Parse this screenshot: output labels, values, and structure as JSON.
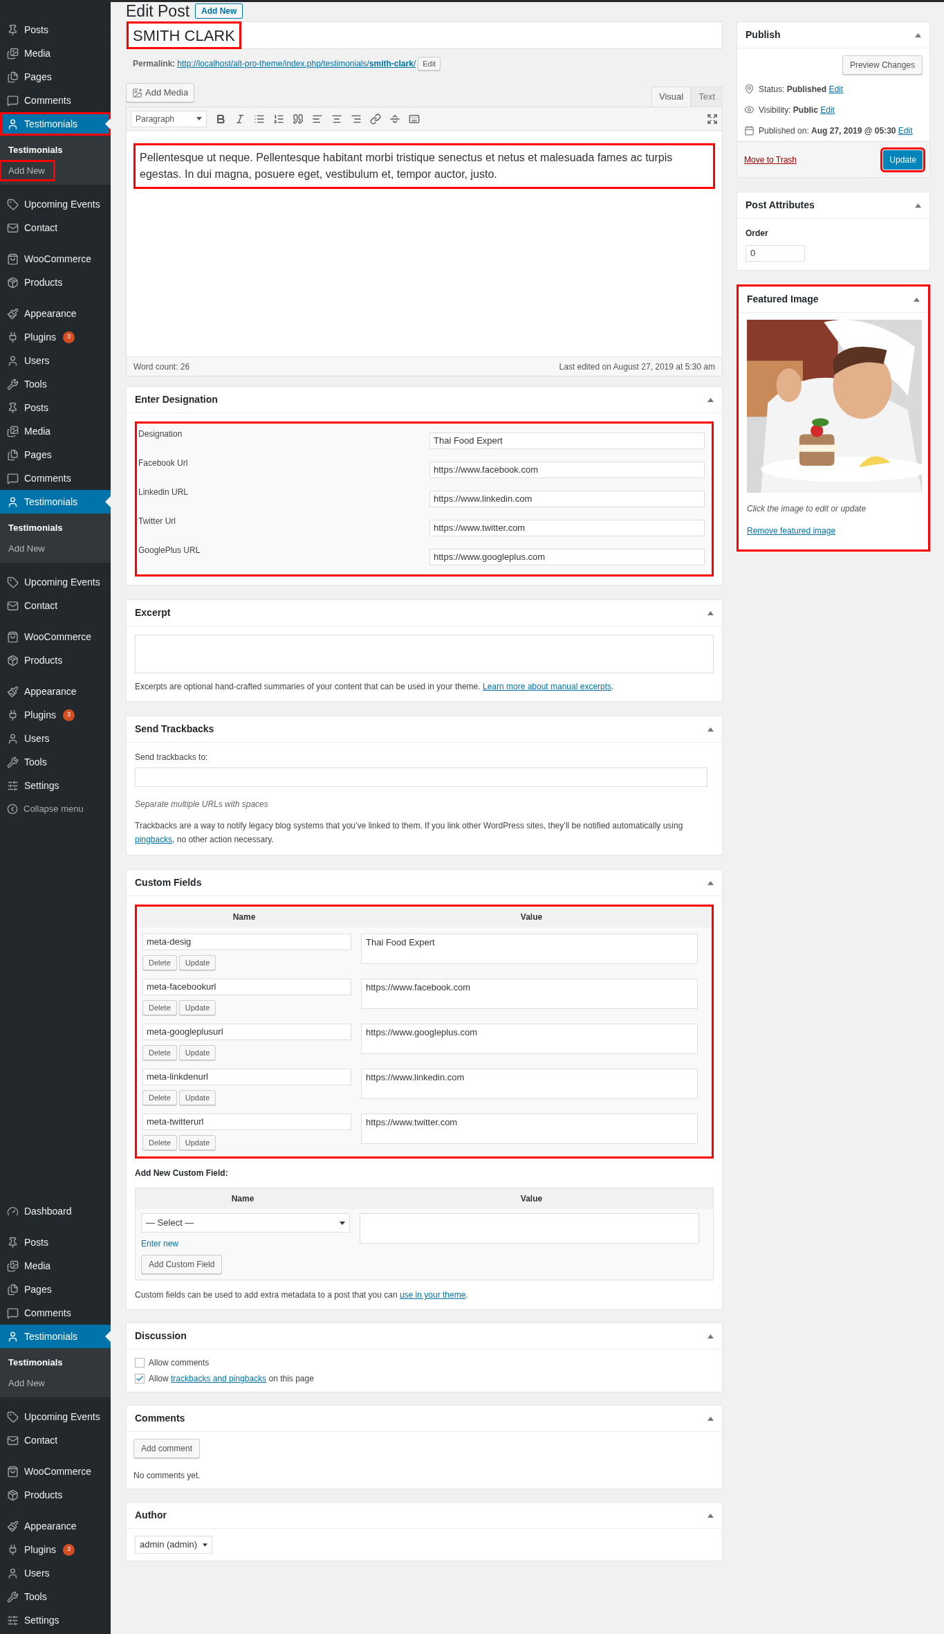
{
  "sidebar": {
    "menus": [
      {
        "sections": [
          [
            {
              "label": "Posts",
              "kind": "pin",
              "selected": false,
              "annotated": false
            },
            {
              "label": "Media",
              "kind": "media",
              "selected": false,
              "annotated": false
            },
            {
              "label": "Pages",
              "kind": "pages",
              "selected": false,
              "annotated": false
            },
            {
              "label": "Comments",
              "kind": "comment",
              "selected": false,
              "annotated": false
            },
            {
              "label": "Testimonials",
              "kind": "person",
              "selected": true,
              "annotated": true,
              "submenu": [
                {
                  "label": "Testimonials",
                  "selected": true,
                  "annotated": false
                },
                {
                  "label": "Add New",
                  "selected": false,
                  "annotated": true
                }
              ]
            }
          ],
          [
            {
              "label": "Upcoming Events",
              "kind": "tag",
              "selected": false,
              "annotated": false
            },
            {
              "label": "Contact",
              "kind": "mail",
              "selected": false,
              "annotated": false
            }
          ],
          [
            {
              "label": "WooCommerce",
              "kind": "woo",
              "selected": false,
              "annotated": false
            },
            {
              "label": "Products",
              "kind": "box",
              "selected": false,
              "annotated": false
            }
          ],
          [
            {
              "label": "Appearance",
              "kind": "brush",
              "selected": false,
              "annotated": false
            },
            {
              "label": "Plugins",
              "kind": "plug",
              "selected": false,
              "annotated": false,
              "badge": "3"
            },
            {
              "label": "Users",
              "kind": "person",
              "selected": false,
              "annotated": false
            },
            {
              "label": "Tools",
              "kind": "wrench",
              "selected": false,
              "annotated": false
            }
          ]
        ]
      },
      {
        "sections": [
          [
            {
              "label": "Posts",
              "kind": "pin",
              "selected": false,
              "annotated": false
            },
            {
              "label": "Media",
              "kind": "media",
              "selected": false,
              "annotated": false
            },
            {
              "label": "Pages",
              "kind": "pages",
              "selected": false,
              "annotated": false
            },
            {
              "label": "Comments",
              "kind": "comment",
              "selected": false,
              "annotated": false
            },
            {
              "label": "Testimonials",
              "kind": "person",
              "selected": true,
              "annotated": false,
              "submenu": [
                {
                  "label": "Testimonials",
                  "selected": true,
                  "annotated": false
                },
                {
                  "label": "Add New",
                  "selected": false,
                  "annotated": false
                }
              ]
            }
          ],
          [
            {
              "label": "Upcoming Events",
              "kind": "tag",
              "selected": false,
              "annotated": false
            },
            {
              "label": "Contact",
              "kind": "mail",
              "selected": false,
              "annotated": false
            }
          ],
          [
            {
              "label": "WooCommerce",
              "kind": "woo",
              "selected": false,
              "annotated": false
            },
            {
              "label": "Products",
              "kind": "box",
              "selected": false,
              "annotated": false
            }
          ],
          [
            {
              "label": "Appearance",
              "kind": "brush",
              "selected": false,
              "annotated": false
            },
            {
              "label": "Plugins",
              "kind": "plug",
              "selected": false,
              "annotated": false,
              "badge": "3"
            },
            {
              "label": "Users",
              "kind": "person",
              "selected": false,
              "annotated": false
            },
            {
              "label": "Tools",
              "kind": "wrench",
              "selected": false,
              "annotated": false
            },
            {
              "label": "Settings",
              "kind": "sliders",
              "selected": false,
              "annotated": false
            },
            {
              "label": "Collapse menu",
              "kind": "collapse",
              "selected": false,
              "annotated": false
            }
          ]
        ]
      },
      {
        "sections": [
          [
            {
              "label": "Dashboard",
              "kind": "gauge",
              "selected": false,
              "annotated": false
            }
          ],
          [
            {
              "label": "Posts",
              "kind": "pin",
              "selected": false,
              "annotated": false
            },
            {
              "label": "Media",
              "kind": "media",
              "selected": false,
              "annotated": false
            },
            {
              "label": "Pages",
              "kind": "pages",
              "selected": false,
              "annotated": false
            },
            {
              "label": "Comments",
              "kind": "comment",
              "selected": false,
              "annotated": false
            },
            {
              "label": "Testimonials",
              "kind": "person",
              "selected": true,
              "annotated": false,
              "submenu": [
                {
                  "label": "Testimonials",
                  "selected": true,
                  "annotated": false
                },
                {
                  "label": "Add New",
                  "selected": false,
                  "annotated": false
                }
              ]
            }
          ],
          [
            {
              "label": "Upcoming Events",
              "kind": "tag",
              "selected": false,
              "annotated": false
            },
            {
              "label": "Contact",
              "kind": "mail",
              "selected": false,
              "annotated": false
            }
          ],
          [
            {
              "label": "WooCommerce",
              "kind": "woo",
              "selected": false,
              "annotated": false
            },
            {
              "label": "Products",
              "kind": "box",
              "selected": false,
              "annotated": false
            }
          ],
          [
            {
              "label": "Appearance",
              "kind": "brush",
              "selected": false,
              "annotated": false
            },
            {
              "label": "Plugins",
              "kind": "plug",
              "selected": false,
              "annotated": false,
              "badge": "3"
            },
            {
              "label": "Users",
              "kind": "person",
              "selected": false,
              "annotated": false
            },
            {
              "label": "Tools",
              "kind": "wrench",
              "selected": false,
              "annotated": false
            },
            {
              "label": "Settings",
              "kind": "sliders",
              "selected": false,
              "annotated": false
            }
          ]
        ]
      }
    ]
  },
  "heading": {
    "title": "Edit Post",
    "add_new": "Add New"
  },
  "title_field": {
    "value": "SMITH CLARK",
    "annotated": true
  },
  "permalink": {
    "label": "Permalink:",
    "url": "http://localhost/alt-pro-theme/index.php/testimonials/**smith-clark**/",
    "edit": "Edit"
  },
  "editor": {
    "add_media": "Add Media",
    "tabs": [
      {
        "label": "Visual",
        "selected": true
      },
      {
        "label": "Text",
        "selected": false
      }
    ],
    "format": "Paragraph",
    "content": "Pellentesque ut neque. Pellentesque habitant morbi tristique senectus et netus et malesuada fames ac turpis egestas. In dui magna, posuere eget, vestibulum et, tempor auctor, justo.",
    "content_annotated": true,
    "word_count": "Word count: 26",
    "last_edited": "Last edited on August 27, 2019 at 5:30 am"
  },
  "designation": {
    "title": "Enter Designation",
    "annotated": true,
    "fields": [
      {
        "label": "Designation",
        "value": "Thai Food Expert"
      },
      {
        "label": "Facebook Url",
        "value": "https://www.facebook.com"
      },
      {
        "label": "Linkedin URL",
        "value": "https://www.linkedin.com"
      },
      {
        "label": "Twitter Url",
        "value": "https://www.twitter.com"
      },
      {
        "label": "GooglePlus URL",
        "value": "https://www.googleplus.com"
      }
    ]
  },
  "excerpt": {
    "title": "Excerpt",
    "help": "Excerpts are optional hand-crafted summaries of your content that can be used in your theme.",
    "link": "Learn more about manual excerpts",
    "after": "."
  },
  "trackbacks": {
    "title": "Send Trackbacks",
    "label": "Send trackbacks to:",
    "hint": "Separate multiple URLs with spaces",
    "text": "Trackbacks are a way to notify legacy blog systems that you’ve linked to them. If you link other WordPress sites, they’ll be notified automatically using",
    "link": "pingbacks",
    "after": ", no other action necessary."
  },
  "custom_fields": {
    "title": "Custom Fields",
    "annotated": true,
    "columns": [
      "Name",
      "Value"
    ],
    "rows": [
      {
        "name": "meta-desig",
        "value": "Thai Food Expert",
        "buttons": [
          "Delete",
          "Update"
        ]
      },
      {
        "name": "meta-facebookurl",
        "value": "https://www.facebook.com",
        "buttons": [
          "Delete",
          "Update"
        ]
      },
      {
        "name": "meta-googleplusurl",
        "value": "https://www.googleplus.com",
        "buttons": [
          "Delete",
          "Update"
        ]
      },
      {
        "name": "meta-linkdenurl",
        "value": "https://www.linkedin.com",
        "buttons": [
          "Delete",
          "Update"
        ]
      },
      {
        "name": "meta-twitterurl",
        "value": "https://www.twitter.com",
        "buttons": [
          "Delete",
          "Update"
        ]
      }
    ],
    "add_new": {
      "title": "Add New Custom Field:",
      "columns": [
        "Name",
        "Value"
      ],
      "select": "— Select —",
      "enter_new": "Enter new",
      "button": "Add Custom Field"
    },
    "help": "Custom fields can be used to add extra metadata to a post that you can",
    "link": "use in your theme",
    "after": "."
  },
  "discussion": {
    "title": "Discussion",
    "options": [
      {
        "text": "Allow comments",
        "checked": false
      },
      {
        "text": "Allow",
        "link": "trackbacks and pingbacks",
        "after": "on this page",
        "checked": true
      }
    ]
  },
  "comments": {
    "title": "Comments",
    "button": "Add comment",
    "empty": "No comments yet."
  },
  "author": {
    "title": "Author",
    "value": "admin (admin)"
  },
  "publish": {
    "title": "Publish",
    "preview": "Preview Changes",
    "rows": [
      {
        "kind": "status",
        "label": "Status:",
        "value": "Published",
        "edit": "Edit"
      },
      {
        "kind": "visibility",
        "label": "Visibility:",
        "value": "Public",
        "edit": "Edit"
      },
      {
        "kind": "date",
        "label": "Published on:",
        "value": "Aug 27, 2019 @ 05:30",
        "edit": "Edit"
      }
    ],
    "trash": "Move to Trash",
    "update": "Update",
    "update_annotated": true
  },
  "attributes": {
    "title": "Post Attributes",
    "label": "Order",
    "value": "0"
  },
  "featured": {
    "title": "Featured Image",
    "annotated": true,
    "hint": "Click the image to edit or update",
    "remove": "Remove featured image"
  }
}
